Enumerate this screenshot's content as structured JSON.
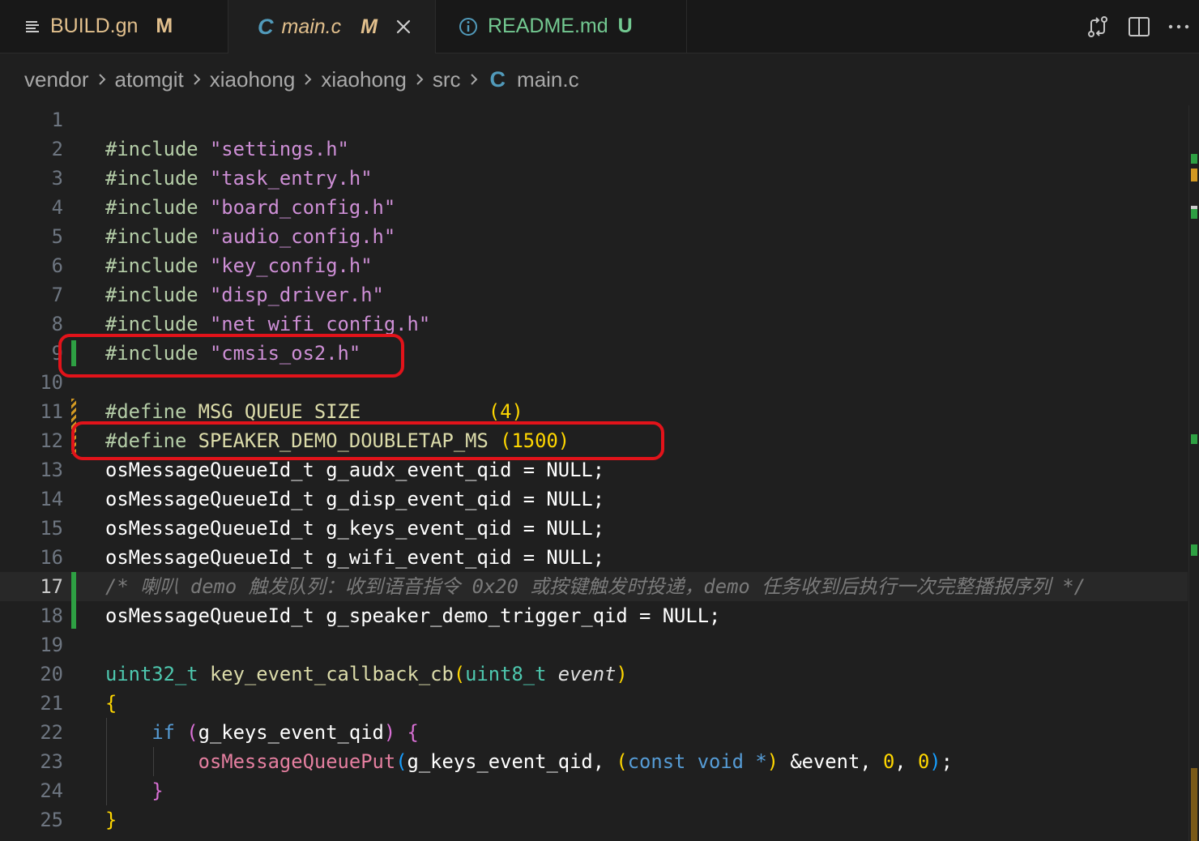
{
  "tabs": [
    {
      "icon": "list-icon",
      "name": "BUILD.gn",
      "badge": "M"
    },
    {
      "icon": "c-file-icon",
      "icon_text": "C",
      "name": "main.c",
      "badge": "M",
      "active": true
    },
    {
      "icon": "info-icon",
      "name": "README.md",
      "badge": "U"
    }
  ],
  "tab_actions": [
    "compare-changes-icon",
    "split-editor-icon",
    "more-actions-icon"
  ],
  "breadcrumb": {
    "items": [
      "vendor",
      "atomgit",
      "xiaohong",
      "xiaohong",
      "src"
    ],
    "file_icon": "C",
    "file": "main.c"
  },
  "editor": {
    "current_line": 17,
    "lines": [
      {
        "n": "1",
        "text": ""
      },
      {
        "n": "2",
        "text": "#include \"settings.h\""
      },
      {
        "n": "3",
        "text": "#include \"task_entry.h\""
      },
      {
        "n": "4",
        "text": "#include \"board_config.h\""
      },
      {
        "n": "5",
        "text": "#include \"audio_config.h\""
      },
      {
        "n": "6",
        "text": "#include \"key_config.h\""
      },
      {
        "n": "7",
        "text": "#include \"disp_driver.h\""
      },
      {
        "n": "8",
        "text": "#include \"net_wifi_config.h\""
      },
      {
        "n": "9",
        "text": "#include \"cmsis_os2.h\""
      },
      {
        "n": "10",
        "text": ""
      },
      {
        "n": "11",
        "text": "#define MSG_QUEUE_SIZE           (4)"
      },
      {
        "n": "12",
        "text": "#define SPEAKER_DEMO_DOUBLETAP_MS (1500)"
      },
      {
        "n": "13",
        "text": "osMessageQueueId_t g_audx_event_qid = NULL;"
      },
      {
        "n": "14",
        "text": "osMessageQueueId_t g_disp_event_qid = NULL;"
      },
      {
        "n": "15",
        "text": "osMessageQueueId_t g_keys_event_qid = NULL;"
      },
      {
        "n": "16",
        "text": "osMessageQueueId_t g_wifi_event_qid = NULL;"
      },
      {
        "n": "17",
        "text": "/* 喇叭 demo 触发队列：收到语音指令 0x20 或按键触发时投递，demo 任务收到后执行一次完整播报序列 */"
      },
      {
        "n": "18",
        "text": "osMessageQueueId_t g_speaker_demo_trigger_qid = NULL;"
      },
      {
        "n": "19",
        "text": ""
      },
      {
        "n": "20",
        "text": "uint32_t key_event_callback_cb(uint8_t event)"
      },
      {
        "n": "21",
        "text": "{"
      },
      {
        "n": "22",
        "text": "    if (g_keys_event_qid) {"
      },
      {
        "n": "23",
        "text": "        osMessageQueuePut(g_keys_event_qid, (const void *) &event, 0, 0);"
      },
      {
        "n": "24",
        "text": "    }"
      },
      {
        "n": "25",
        "text": "}"
      }
    ]
  },
  "code_tokens": {
    "inc": "#include",
    "def": "#define",
    "h2": "\"settings.h\"",
    "h3": "\"task_entry.h\"",
    "h4": "\"board_config.h\"",
    "h5": "\"audio_config.h\"",
    "h6": "\"key_config.h\"",
    "h7": "\"disp_driver.h\"",
    "h8": "\"net_wifi_config.h\"",
    "h9": "\"cmsis_os2.h\"",
    "d11": "MSG_QUEUE_SIZE",
    "d11v": "(4)",
    "d12": "SPEAKER_DEMO_DOUBLETAP_MS",
    "d12v": "(1500)",
    "type": "osMessageQueueId_t",
    "v13": "g_audx_event_qid",
    "v14": "g_disp_event_qid",
    "v15": "g_keys_event_qid",
    "v16": "g_wifi_event_qid",
    "v18": "g_speaker_demo_trigger_qid",
    "assign_null": " = NULL;",
    "c17": "/* 喇叭 demo 触发队列：收到语音指令 0x20 或按键触发时投递，demo 任务收到后执行一次完整播报序列 */",
    "u32": "uint32_t",
    "fn20": "key_event_callback_cb",
    "u8": "uint8_t",
    "p20": "event",
    "kwif": "if",
    "v22": "g_keys_event_qid",
    "fn23": "osMessageQueuePut",
    "a23": "g_keys_event_qid, ",
    "const": "const",
    "void": "void",
    "ptr": " *",
    "ev": "&event, ",
    "z": "0",
    "comma": ", "
  },
  "colors": {
    "annotation": "#e2131a",
    "added": "#2ea043",
    "modified": "#d29922"
  }
}
